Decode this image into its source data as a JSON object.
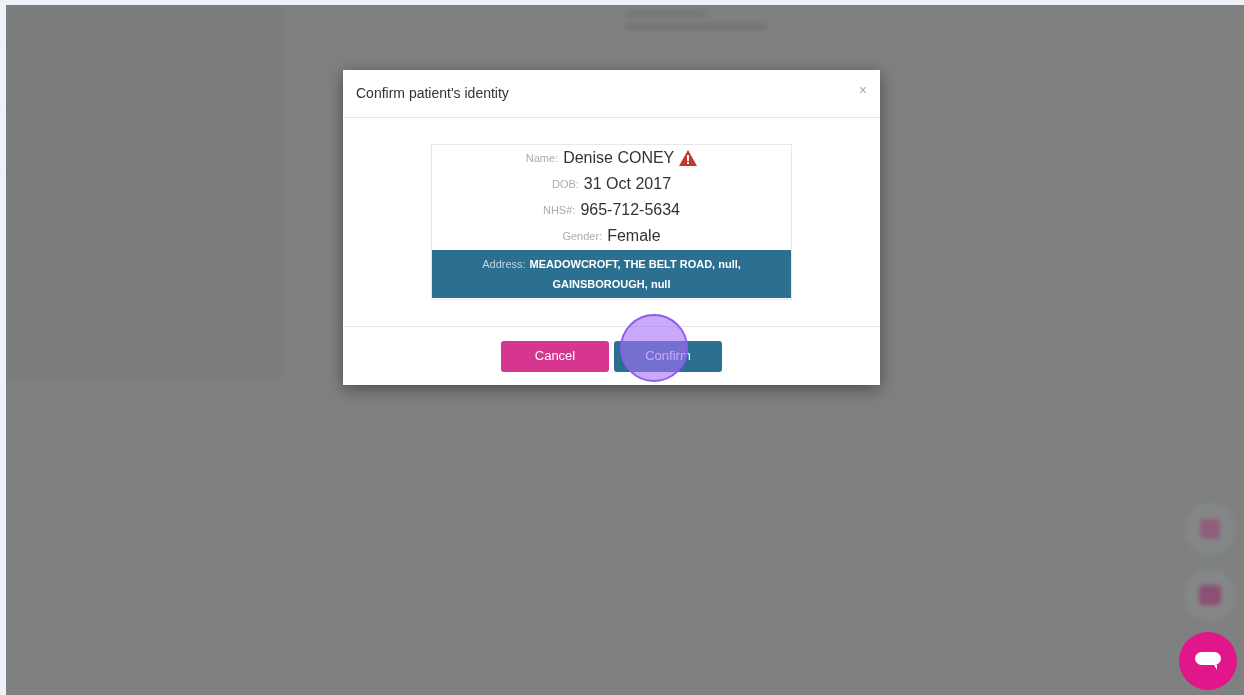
{
  "dialog": {
    "title": "Confirm patient's identity",
    "close": "×",
    "fields": [
      {
        "label": "Name:",
        "value": "Denise CONEY",
        "warning": true,
        "highlighted": false
      },
      {
        "label": "DOB:",
        "value": "31 Oct 2017",
        "warning": false,
        "highlighted": false
      },
      {
        "label": "NHS#:",
        "value": "965-712-5634",
        "warning": false,
        "highlighted": false
      },
      {
        "label": "Gender:",
        "value": "Female",
        "warning": false,
        "highlighted": false
      },
      {
        "label": "Address:",
        "value": "MEADOWCROFT, THE BELT ROAD, null, GAINSBOROUGH, null",
        "warning": false,
        "highlighted": true
      }
    ],
    "buttons": [
      {
        "label": "Cancel",
        "kind": "cancel"
      },
      {
        "label": "Confirm",
        "kind": "confirm"
      }
    ]
  }
}
